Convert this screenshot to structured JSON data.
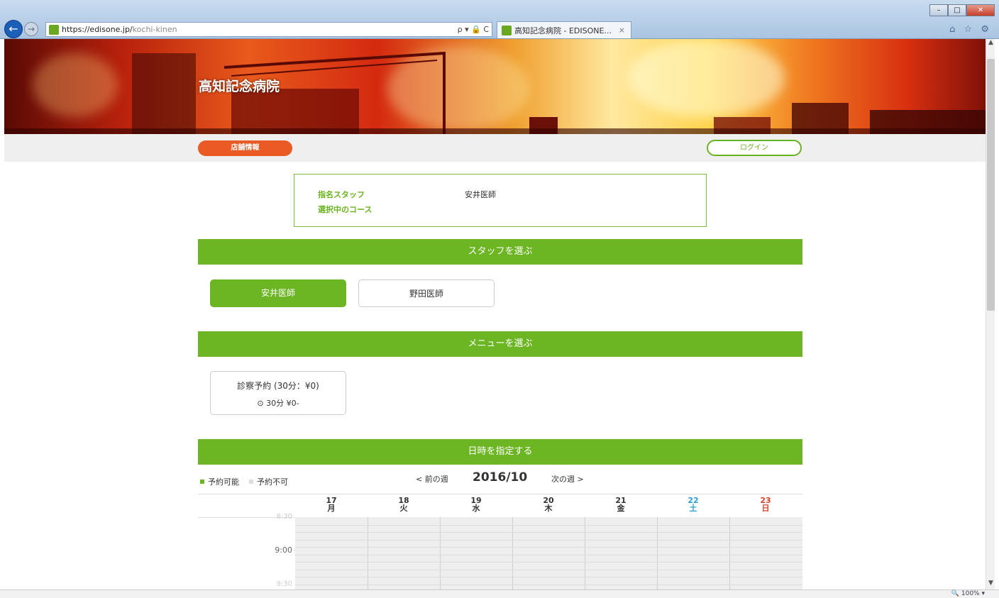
{
  "browser": {
    "url_host": "https://edisone.jp/",
    "url_path": "kochi-kinen",
    "address_tools": "ρ ▾ 🔒 C",
    "tab_title": "高知記念病院 - EDISONE...",
    "tab_close": "×",
    "right_icons": "⌂ ☆ ⚙",
    "zoom": "100%"
  },
  "hero": {
    "title": "高知記念病院"
  },
  "subnav": {
    "shop_info": "店舗情報",
    "login": "ログイン"
  },
  "summary": {
    "staff_label": "指名スタッフ",
    "staff_value": "安井医師",
    "course_label": "選択中のコース",
    "course_value": ""
  },
  "sections": {
    "staff": "スタッフを選ぶ",
    "menu": "メニューを選ぶ",
    "datetime": "日時を指定する"
  },
  "staff_options": [
    {
      "label": "安井医師",
      "selected": true
    },
    {
      "label": "野田医師",
      "selected": false
    }
  ],
  "menu": {
    "title": "診察予約 (30分：¥0)",
    "detail": "30分 ¥0-"
  },
  "calendar": {
    "legend_available": "予約可能",
    "legend_unavailable": "予約不可",
    "prev_week": "< 前の週",
    "next_week": "次の週 >",
    "month": "2016/10",
    "days": [
      {
        "date": "17",
        "dow": "月",
        "color": "#333333"
      },
      {
        "date": "18",
        "dow": "火",
        "color": "#333333"
      },
      {
        "date": "19",
        "dow": "水",
        "color": "#333333"
      },
      {
        "date": "20",
        "dow": "木",
        "color": "#333333"
      },
      {
        "date": "21",
        "dow": "金",
        "color": "#333333"
      },
      {
        "date": "22",
        "dow": "土",
        "color": "#2a9fd6"
      },
      {
        "date": "23",
        "dow": "日",
        "color": "#e0402a"
      }
    ],
    "times": [
      "8:30",
      "9:00",
      "9:30"
    ]
  },
  "colors": {
    "accent_green": "#6cb523",
    "accent_orange": "#e95a25"
  }
}
